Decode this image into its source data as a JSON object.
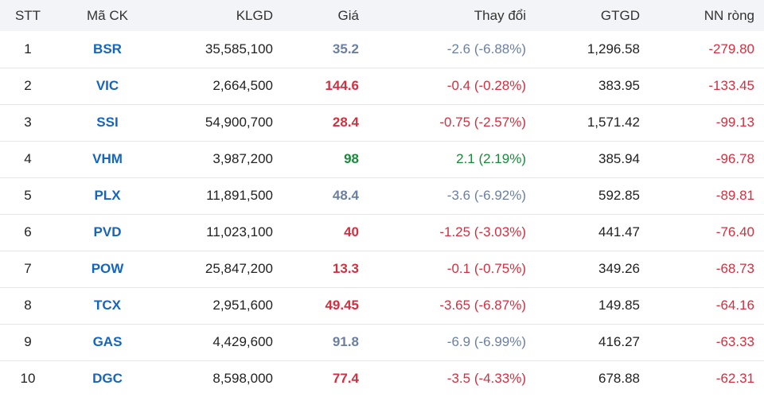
{
  "headers": {
    "stt": "STT",
    "ma_ck": "Mã CK",
    "klgd": "KLGD",
    "gia": "Giá",
    "thay_doi": "Thay đổi",
    "gtgd": "GTGD",
    "nn_rong": "NN ròng"
  },
  "colors": {
    "ticker": "#1565c0",
    "reference": "#6b7fa3",
    "down": "#d32f3f",
    "up": "#188a3a",
    "header_bg": "#f3f4f8"
  },
  "rows": [
    {
      "stt": "1",
      "ma": "BSR",
      "klgd": "35,585,100",
      "gia": "35.2",
      "thay_doi": "-2.6 (-6.88%)",
      "gtgd": "1,296.58",
      "nn": "-279.80",
      "status": "ref"
    },
    {
      "stt": "2",
      "ma": "VIC",
      "klgd": "2,664,500",
      "gia": "144.6",
      "thay_doi": "-0.4 (-0.28%)",
      "gtgd": "383.95",
      "nn": "-133.45",
      "status": "down"
    },
    {
      "stt": "3",
      "ma": "SSI",
      "klgd": "54,900,700",
      "gia": "28.4",
      "thay_doi": "-0.75 (-2.57%)",
      "gtgd": "1,571.42",
      "nn": "-99.13",
      "status": "down"
    },
    {
      "stt": "4",
      "ma": "VHM",
      "klgd": "3,987,200",
      "gia": "98",
      "thay_doi": "2.1 (2.19%)",
      "gtgd": "385.94",
      "nn": "-96.78",
      "status": "up"
    },
    {
      "stt": "5",
      "ma": "PLX",
      "klgd": "11,891,500",
      "gia": "48.4",
      "thay_doi": "-3.6 (-6.92%)",
      "gtgd": "592.85",
      "nn": "-89.81",
      "status": "ref"
    },
    {
      "stt": "6",
      "ma": "PVD",
      "klgd": "11,023,100",
      "gia": "40",
      "thay_doi": "-1.25 (-3.03%)",
      "gtgd": "441.47",
      "nn": "-76.40",
      "status": "down"
    },
    {
      "stt": "7",
      "ma": "POW",
      "klgd": "25,847,200",
      "gia": "13.3",
      "thay_doi": "-0.1 (-0.75%)",
      "gtgd": "349.26",
      "nn": "-68.73",
      "status": "down"
    },
    {
      "stt": "8",
      "ma": "TCX",
      "klgd": "2,951,600",
      "gia": "49.45",
      "thay_doi": "-3.65 (-6.87%)",
      "gtgd": "149.85",
      "nn": "-64.16",
      "status": "down"
    },
    {
      "stt": "9",
      "ma": "GAS",
      "klgd": "4,429,600",
      "gia": "91.8",
      "thay_doi": "-6.9 (-6.99%)",
      "gtgd": "416.27",
      "nn": "-63.33",
      "status": "ref"
    },
    {
      "stt": "10",
      "ma": "DGC",
      "klgd": "8,598,000",
      "gia": "77.4",
      "thay_doi": "-3.5 (-4.33%)",
      "gtgd": "678.88",
      "nn": "-62.31",
      "status": "down"
    }
  ]
}
